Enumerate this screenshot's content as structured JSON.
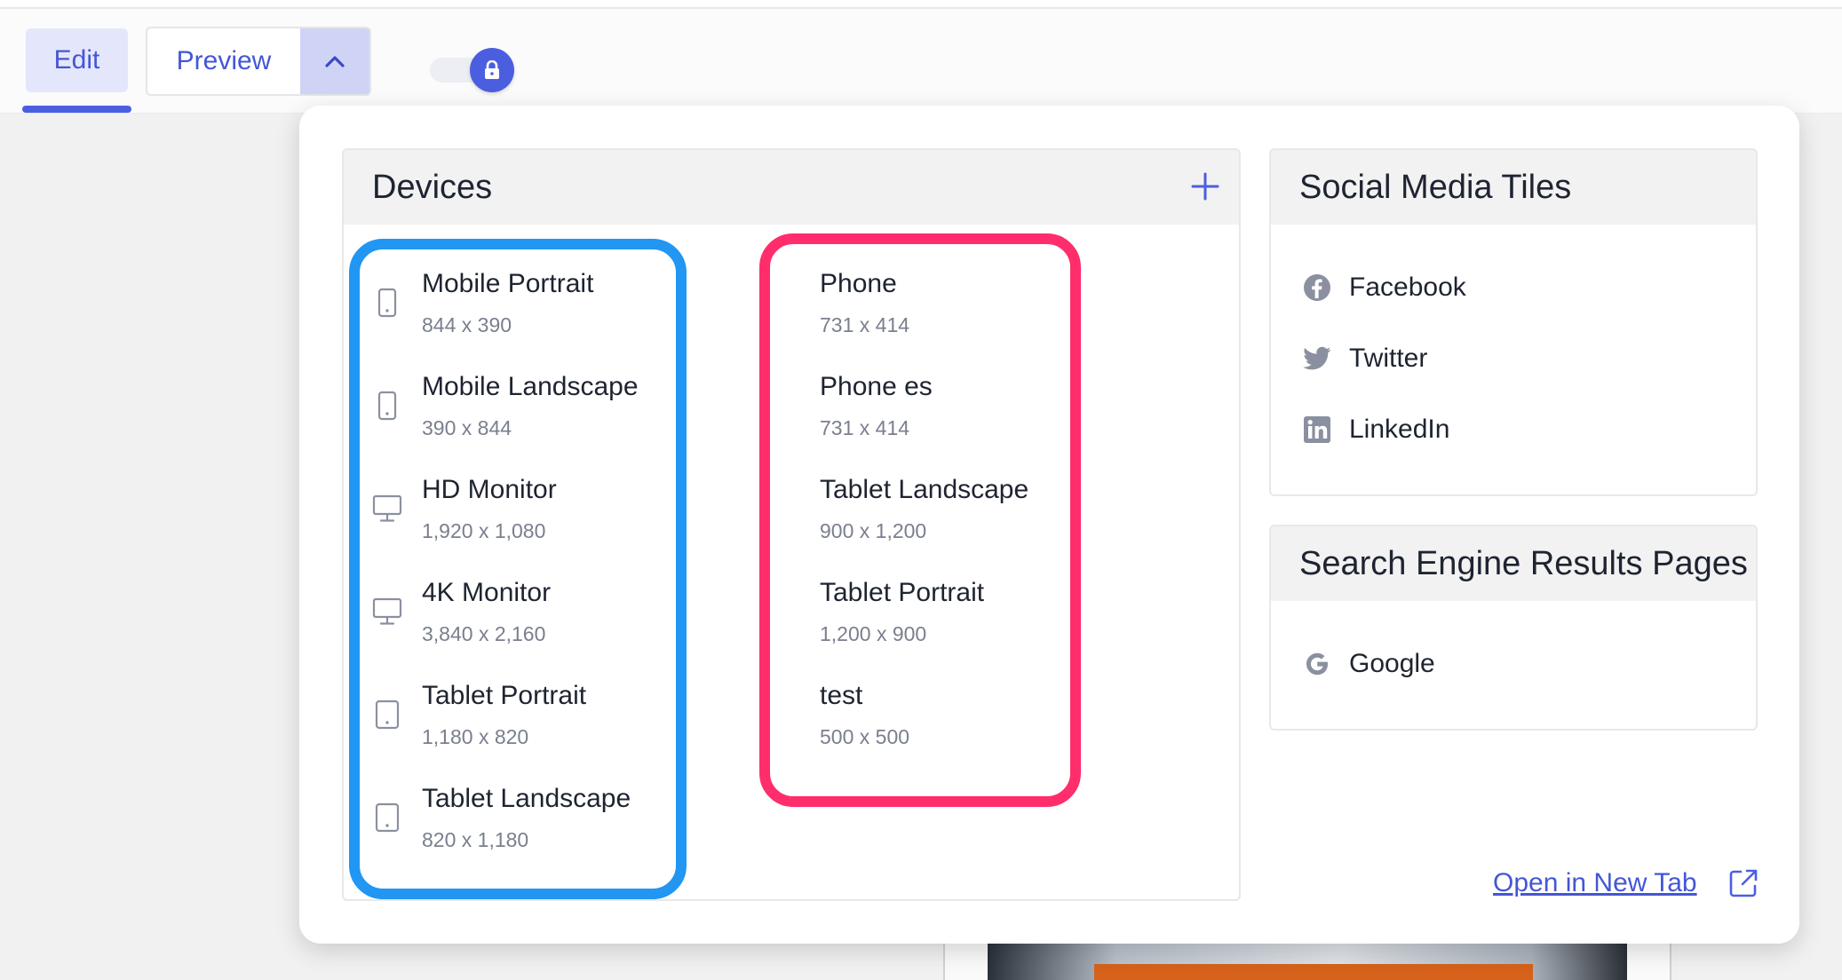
{
  "toolbar": {
    "edit_label": "Edit",
    "preview_label": "Preview"
  },
  "colors": {
    "accent": "#4c5ee0",
    "devices_left_highlight": "#2196f3",
    "devices_right_highlight": "#ff2d6b"
  },
  "devices": {
    "title": "Devices",
    "left": [
      {
        "name": "Mobile Portrait",
        "size": "844 x 390",
        "icon": "phone-icon"
      },
      {
        "name": "Mobile Landscape",
        "size": "390 x 844",
        "icon": "phone-icon"
      },
      {
        "name": "HD Monitor",
        "size": "1,920 x 1,080",
        "icon": "monitor-icon"
      },
      {
        "name": "4K Monitor",
        "size": "3,840 x 2,160",
        "icon": "monitor-icon"
      },
      {
        "name": "Tablet Portrait",
        "size": "1,180 x 820",
        "icon": "tablet-icon"
      },
      {
        "name": "Tablet Landscape",
        "size": "820 x 1,180",
        "icon": "tablet-icon"
      }
    ],
    "right": [
      {
        "name": "Phone",
        "size": "731 x 414"
      },
      {
        "name": "Phone es",
        "size": "731 x 414"
      },
      {
        "name": "Tablet Landscape",
        "size": "900 x 1,200"
      },
      {
        "name": "Tablet Portrait",
        "size": "1,200 x 900"
      },
      {
        "name": "test",
        "size": "500 x 500"
      }
    ]
  },
  "social": {
    "title": "Social Media Tiles",
    "items": [
      {
        "label": "Facebook",
        "icon": "facebook-icon"
      },
      {
        "label": "Twitter",
        "icon": "twitter-icon"
      },
      {
        "label": "LinkedIn",
        "icon": "linkedin-icon"
      }
    ]
  },
  "serp": {
    "title": "Search Engine Results Pages",
    "items": [
      {
        "label": "Google",
        "icon": "google-icon"
      }
    ]
  },
  "footer": {
    "open_new_tab": "Open in New Tab"
  }
}
